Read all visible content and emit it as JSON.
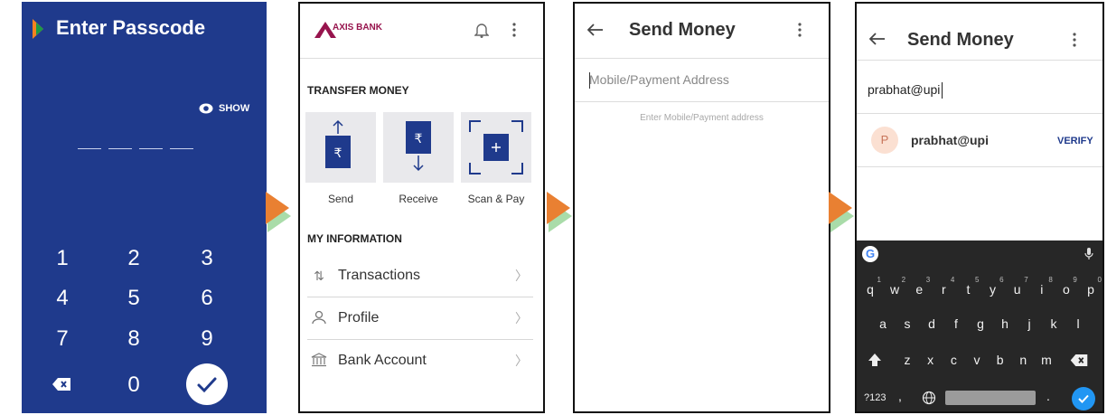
{
  "passcode": {
    "title": "Enter Passcode",
    "show_label": "SHOW",
    "keys": [
      "1",
      "2",
      "3",
      "4",
      "5",
      "6",
      "7",
      "8",
      "9",
      "0"
    ]
  },
  "bank": {
    "brand": "AXIS BANK",
    "transfer_title": "TRANSFER MONEY",
    "tiles": [
      {
        "label": "Send"
      },
      {
        "label": "Receive"
      },
      {
        "label": "Scan & Pay"
      }
    ],
    "info_title": "MY INFORMATION",
    "rows": [
      {
        "label": "Transactions",
        "icon": "arrows-updown-icon"
      },
      {
        "label": "Profile",
        "icon": "person-icon"
      },
      {
        "label": "Bank Account",
        "icon": "bank-icon"
      }
    ]
  },
  "send_empty": {
    "title": "Send Money",
    "placeholder": "Mobile/Payment Address",
    "hint": "Enter Mobile/Payment address"
  },
  "send_filled": {
    "title": "Send Money",
    "input_value": "prabhat@upi",
    "suggestion_initial": "P",
    "suggestion_name": "prabhat@upi",
    "verify_label": "VERIFY"
  },
  "keyboard": {
    "row1": [
      "q",
      "w",
      "e",
      "r",
      "t",
      "y",
      "u",
      "i",
      "o",
      "p"
    ],
    "row1_nums": [
      "1",
      "2",
      "3",
      "4",
      "5",
      "6",
      "7",
      "8",
      "9",
      "0"
    ],
    "row2": [
      "a",
      "s",
      "d",
      "f",
      "g",
      "h",
      "j",
      "k",
      "l"
    ],
    "row3": [
      "z",
      "x",
      "c",
      "v",
      "b",
      "n",
      "m"
    ],
    "sym_label": "?123",
    "comma": ",",
    "period": "."
  },
  "colors": {
    "passcode_bg": "#1f3a8c",
    "brand": "#97144d",
    "accent": "#1f3a8c",
    "arrow": "#e98032"
  }
}
